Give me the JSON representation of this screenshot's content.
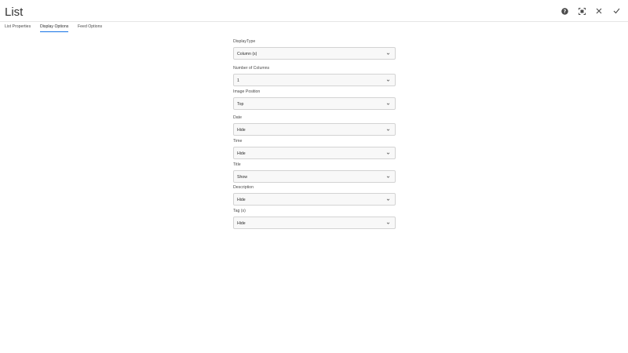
{
  "dialog": {
    "title": "List"
  },
  "header_actions": [
    {
      "name": "help-button",
      "icon": "help-icon"
    },
    {
      "name": "fullscreen-button",
      "icon": "fullscreen-icon"
    },
    {
      "name": "cancel-button",
      "icon": "close-icon"
    },
    {
      "name": "done-button",
      "icon": "checkmark-icon"
    }
  ],
  "tabs": [
    {
      "label": "List Properties",
      "active": false
    },
    {
      "label": "Display Options",
      "active": true
    },
    {
      "label": "Feed Options",
      "active": false
    }
  ],
  "fields": [
    {
      "label": "DisplayType",
      "value": "Column (s)"
    },
    {
      "label": "Number of Columns",
      "value": "1"
    },
    {
      "label": "Image Position",
      "value": "Top"
    },
    {
      "label": "Date",
      "value": "Hide"
    },
    {
      "label": "Time",
      "value": "Hide"
    },
    {
      "label": "Title",
      "value": "Show"
    },
    {
      "label": "Description",
      "value": "Hide"
    },
    {
      "label": "Tag (s)",
      "value": "Hide"
    }
  ],
  "colors": {
    "accent": "#1473e6",
    "text": "#2c2c2c",
    "field_border": "#d3d3d3",
    "field_bg": "#f8f8f8"
  }
}
